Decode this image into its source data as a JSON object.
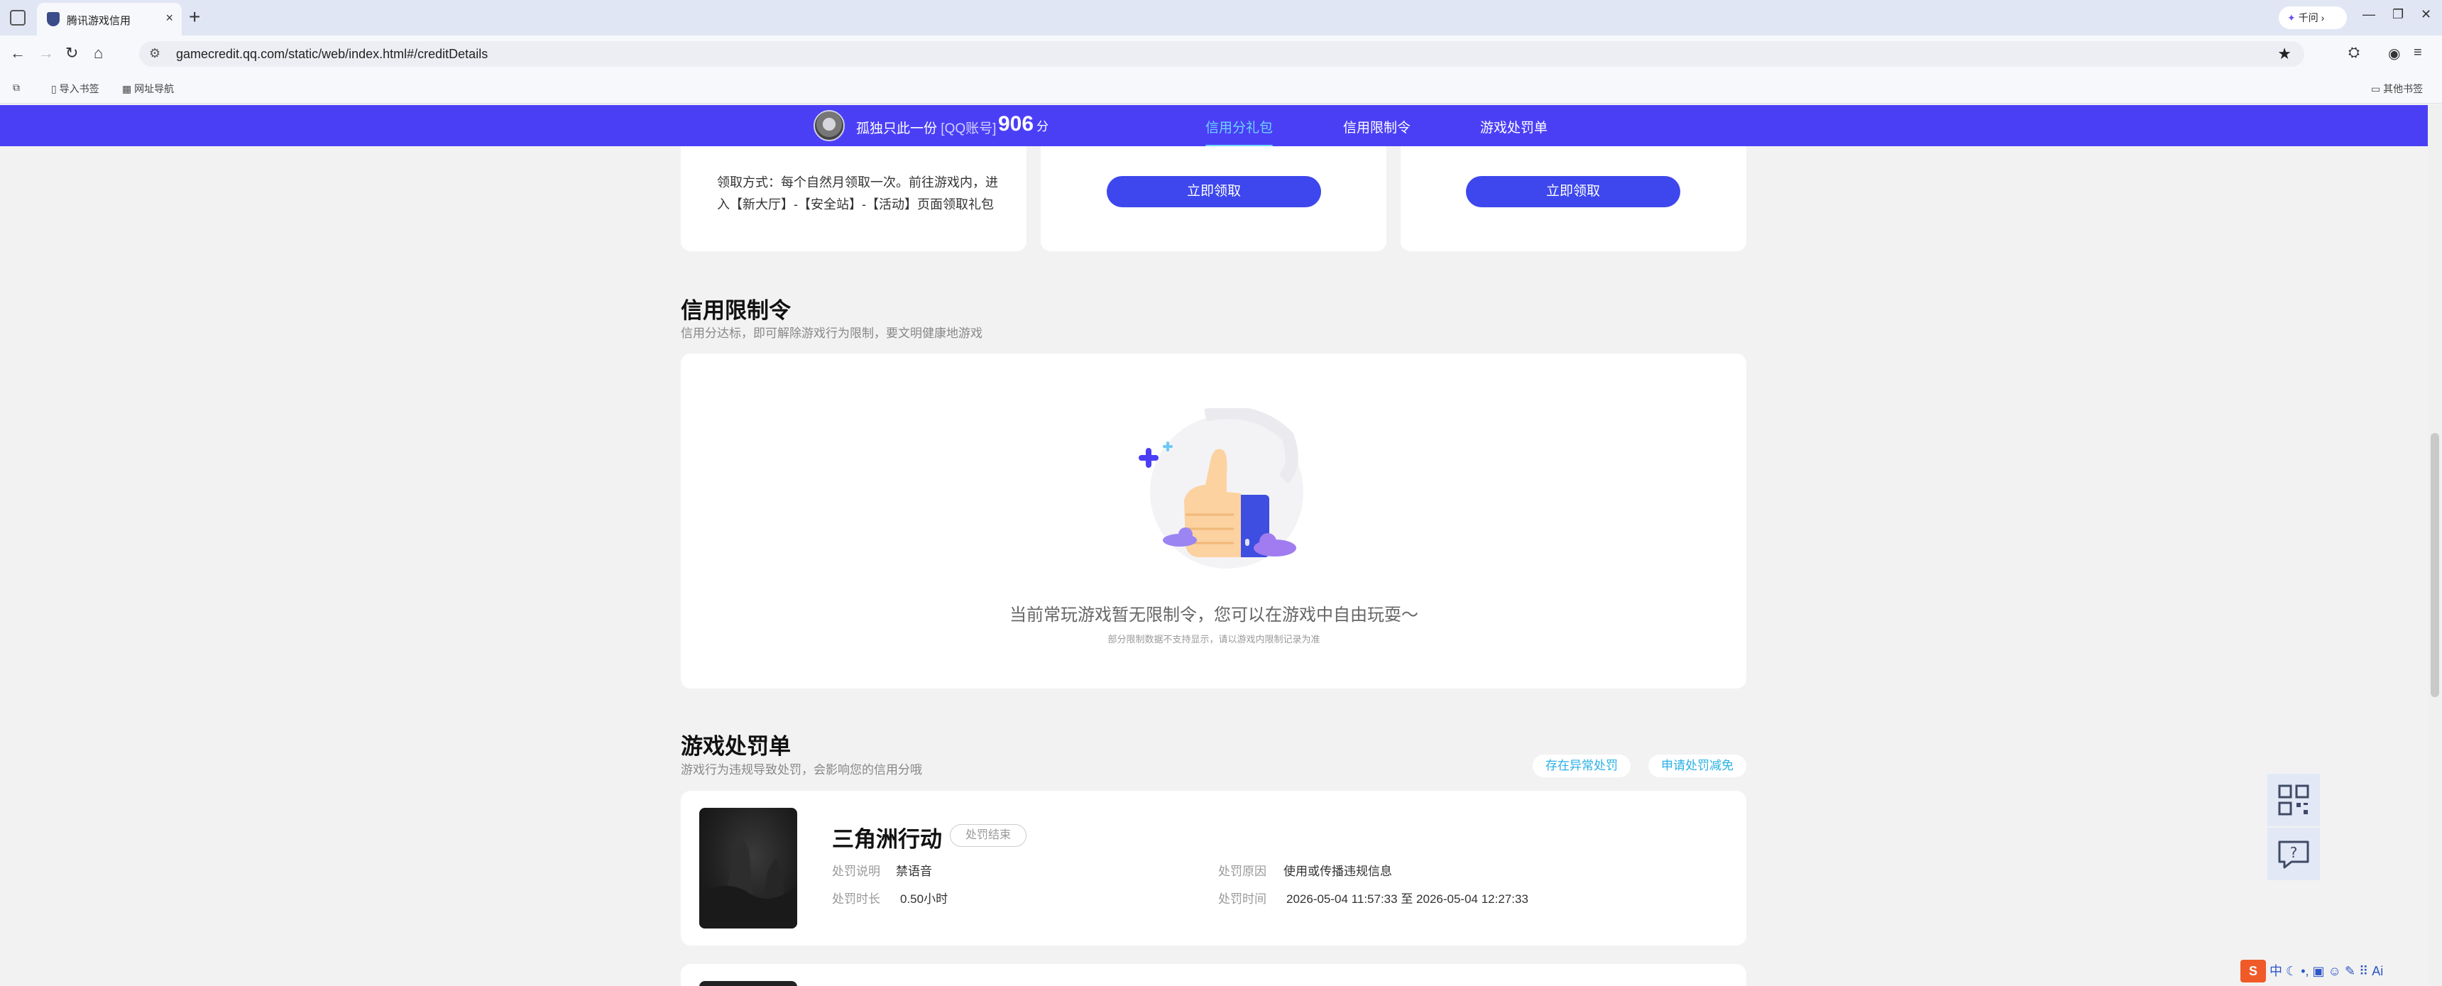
{
  "browser": {
    "tab_title": "腾讯游戏信用",
    "tab_close": "×",
    "new_tab": "+",
    "assistant": "千问 ›",
    "url": "gamecredit.qq.com/static/web/index.html#/creditDetails",
    "bookmarks": {
      "import": "导入书签",
      "nav": "网址导航",
      "other": "其他书签"
    }
  },
  "header": {
    "username": "孤独只此一份",
    "account_tag": "[QQ账号]",
    "score": "906",
    "score_unit": "分",
    "nav": [
      "信用分礼包",
      "信用限制令",
      "游戏处罚单"
    ],
    "active_nav": 0
  },
  "gift": {
    "description": "领取方式：每个自然月领取一次。前往游戏内，进入【新大厅】-【安全站】-【活动】页面领取礼包",
    "claim_label": "立即领取"
  },
  "restriction": {
    "title": "信用限制令",
    "subtitle": "信用分达标，即可解除游戏行为限制，要文明健康地游戏",
    "empty_main": "当前常玩游戏暂无限制令，您可以在游戏中自由玩耍～",
    "empty_sub": "部分限制数据不支持显示，请以游戏内限制记录为准"
  },
  "penalty": {
    "title": "游戏处罚单",
    "subtitle": "游戏行为违规导致处罚，会影响您的信用分哦",
    "action_abnormal": "存在异常处罚",
    "action_appeal": "申请处罚减免",
    "item": {
      "game": "三角洲行动",
      "status": "处罚结束",
      "desc_label": "处罚说明",
      "desc_value": "禁语音",
      "duration_label": "处罚时长",
      "duration_value": "0.50小时",
      "reason_label": "处罚原因",
      "reason_value": "使用或传播违规信息",
      "time_label": "处罚时间",
      "time_value": "2026-05-04 11:57:33 至 2026-05-04 12:27:33"
    }
  },
  "colors": {
    "header_bg": "#4b3ff6",
    "nav_active": "#6cd3ff",
    "primary_btn": "#3d47ed",
    "pill_text": "#29b0e6"
  },
  "icons": {
    "qr": "qr-code-icon",
    "help": "help-chat-icon"
  }
}
